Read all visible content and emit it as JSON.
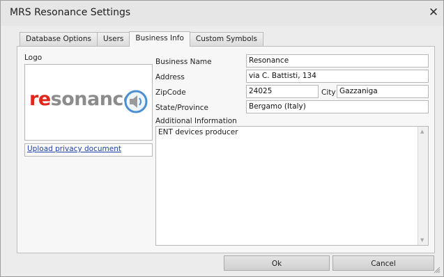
{
  "window": {
    "title": "MRS Resonance Settings",
    "close_glyph": "✕"
  },
  "tabs": [
    {
      "label": "Database Options"
    },
    {
      "label": "Users"
    },
    {
      "label": "Business Info",
      "active": true
    },
    {
      "label": "Custom Symbols"
    }
  ],
  "business_info": {
    "logo_label": "Logo",
    "logo_text_accent": "re",
    "logo_text_rest": "sonance",
    "logo_icon": "speaker-sound-icon",
    "upload_link": "Upload privacy document",
    "business_name_label": "Business Name",
    "business_name_value": "Resonance",
    "address_label": "Address",
    "address_value": "via C. Battisti, 134",
    "zipcode_label": "ZipCode",
    "zipcode_value": "24025",
    "city_label": "City",
    "city_value": "Gazzaniga",
    "state_label": "State/Province",
    "state_value": "Bergamo (Italy)",
    "additional_label": "Additional Information",
    "additional_value": "ENT devices producer"
  },
  "buttons": {
    "ok": "Ok",
    "cancel": "Cancel"
  }
}
